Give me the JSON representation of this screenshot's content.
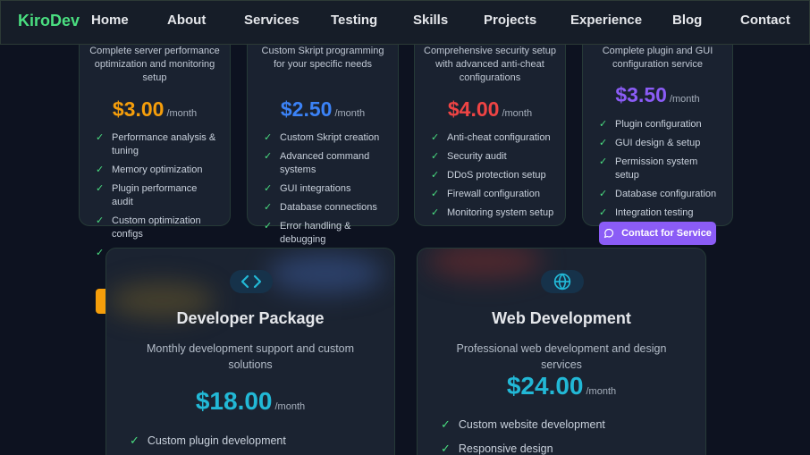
{
  "nav": {
    "brand": "KiroDev",
    "links": [
      "Home",
      "About",
      "Services",
      "Testing",
      "Skills",
      "Projects",
      "Experience",
      "Blog",
      "Contact"
    ]
  },
  "plans": [
    {
      "description": "Complete server performance optimization and monitoring setup",
      "price": "$3.00",
      "period": "/month",
      "price_color": "#f59e0b",
      "features": [
        "Performance analysis & tuning",
        "Memory optimization",
        "Plugin performance audit",
        "Custom optimization configs"
      ]
    },
    {
      "description": "Custom Skript programming for your specific needs",
      "price": "$2.50",
      "period": "/month",
      "price_color": "#3b82f6",
      "features": [
        "Custom Skript creation",
        "Advanced command systems",
        "GUI integrations",
        "Database connections",
        "Error handling & debugging"
      ]
    },
    {
      "description": "Comprehensive security setup with advanced anti-cheat configurations",
      "price": "$4.00",
      "period": "/month",
      "price_color": "#ef4444",
      "features": [
        "Anti-cheat configuration",
        "Security audit",
        "DDoS protection setup",
        "Firewall configuration",
        "Monitoring system setup"
      ]
    },
    {
      "description": "Complete plugin and GUI configuration service",
      "price": "$3.50",
      "period": "/month",
      "price_color": "#8b5cf6",
      "features": [
        "Plugin configuration",
        "GUI design & setup",
        "Permission system setup",
        "Database configuration",
        "Integration testing"
      ]
    }
  ],
  "contact_button": {
    "label": "Contact for Service",
    "icon": "chat-bubble-icon"
  },
  "packages": [
    {
      "icon": "code-brackets-icon",
      "title": "Developer Package",
      "description": "Monthly development support and custom solutions",
      "price": "$18.00",
      "period": "/month",
      "features": [
        "Custom plugin development"
      ]
    },
    {
      "icon": "globe-icon",
      "title": "Web Development",
      "description": "Professional web development and design services",
      "price": "$24.00",
      "period": "/month",
      "features": [
        "Custom website development",
        "Responsive design"
      ]
    }
  ],
  "colors": {
    "accent_green": "#4ade80",
    "accent_cyan": "#22b8d6",
    "background": "#0d1220"
  }
}
